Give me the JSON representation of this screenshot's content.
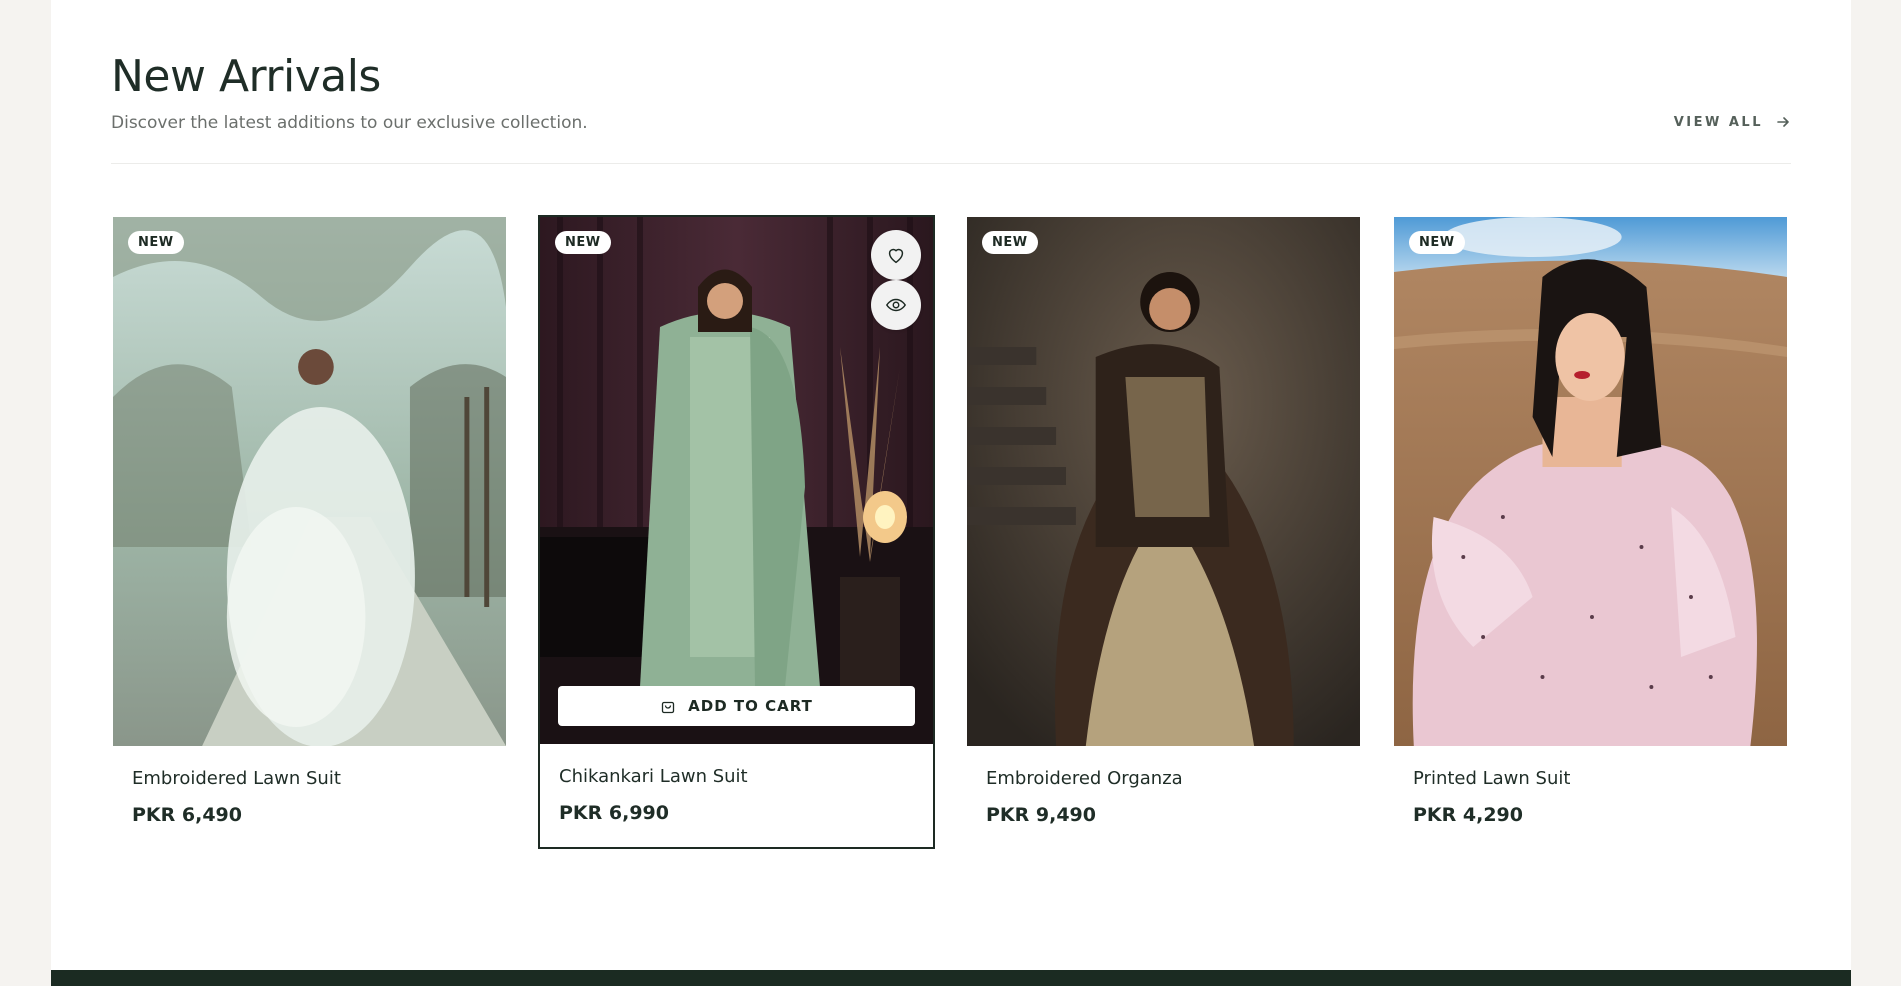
{
  "section": {
    "title": "New Arrivals",
    "subtitle": "Discover the latest additions to our exclusive collection.",
    "view_all": "VIEW ALL"
  },
  "products": [
    {
      "badge": "NEW",
      "name": "Embroidered Lawn Suit",
      "price": "PKR 6,490"
    },
    {
      "badge": "NEW",
      "name": "Chikankari Lawn Suit",
      "price": "PKR 6,990",
      "cart_label": "ADD TO CART"
    },
    {
      "badge": "NEW",
      "name": "Embroidered Organza",
      "price": "PKR 9,490"
    },
    {
      "badge": "NEW",
      "name": "Printed Lawn Suit",
      "price": "PKR 4,290"
    }
  ],
  "colors": {
    "brand_dark": "#1b2b22",
    "page_bg": "#f5f3f0"
  },
  "icons": [
    "arrow-right-icon",
    "heart-icon",
    "eye-icon",
    "shopping-bag-icon"
  ]
}
